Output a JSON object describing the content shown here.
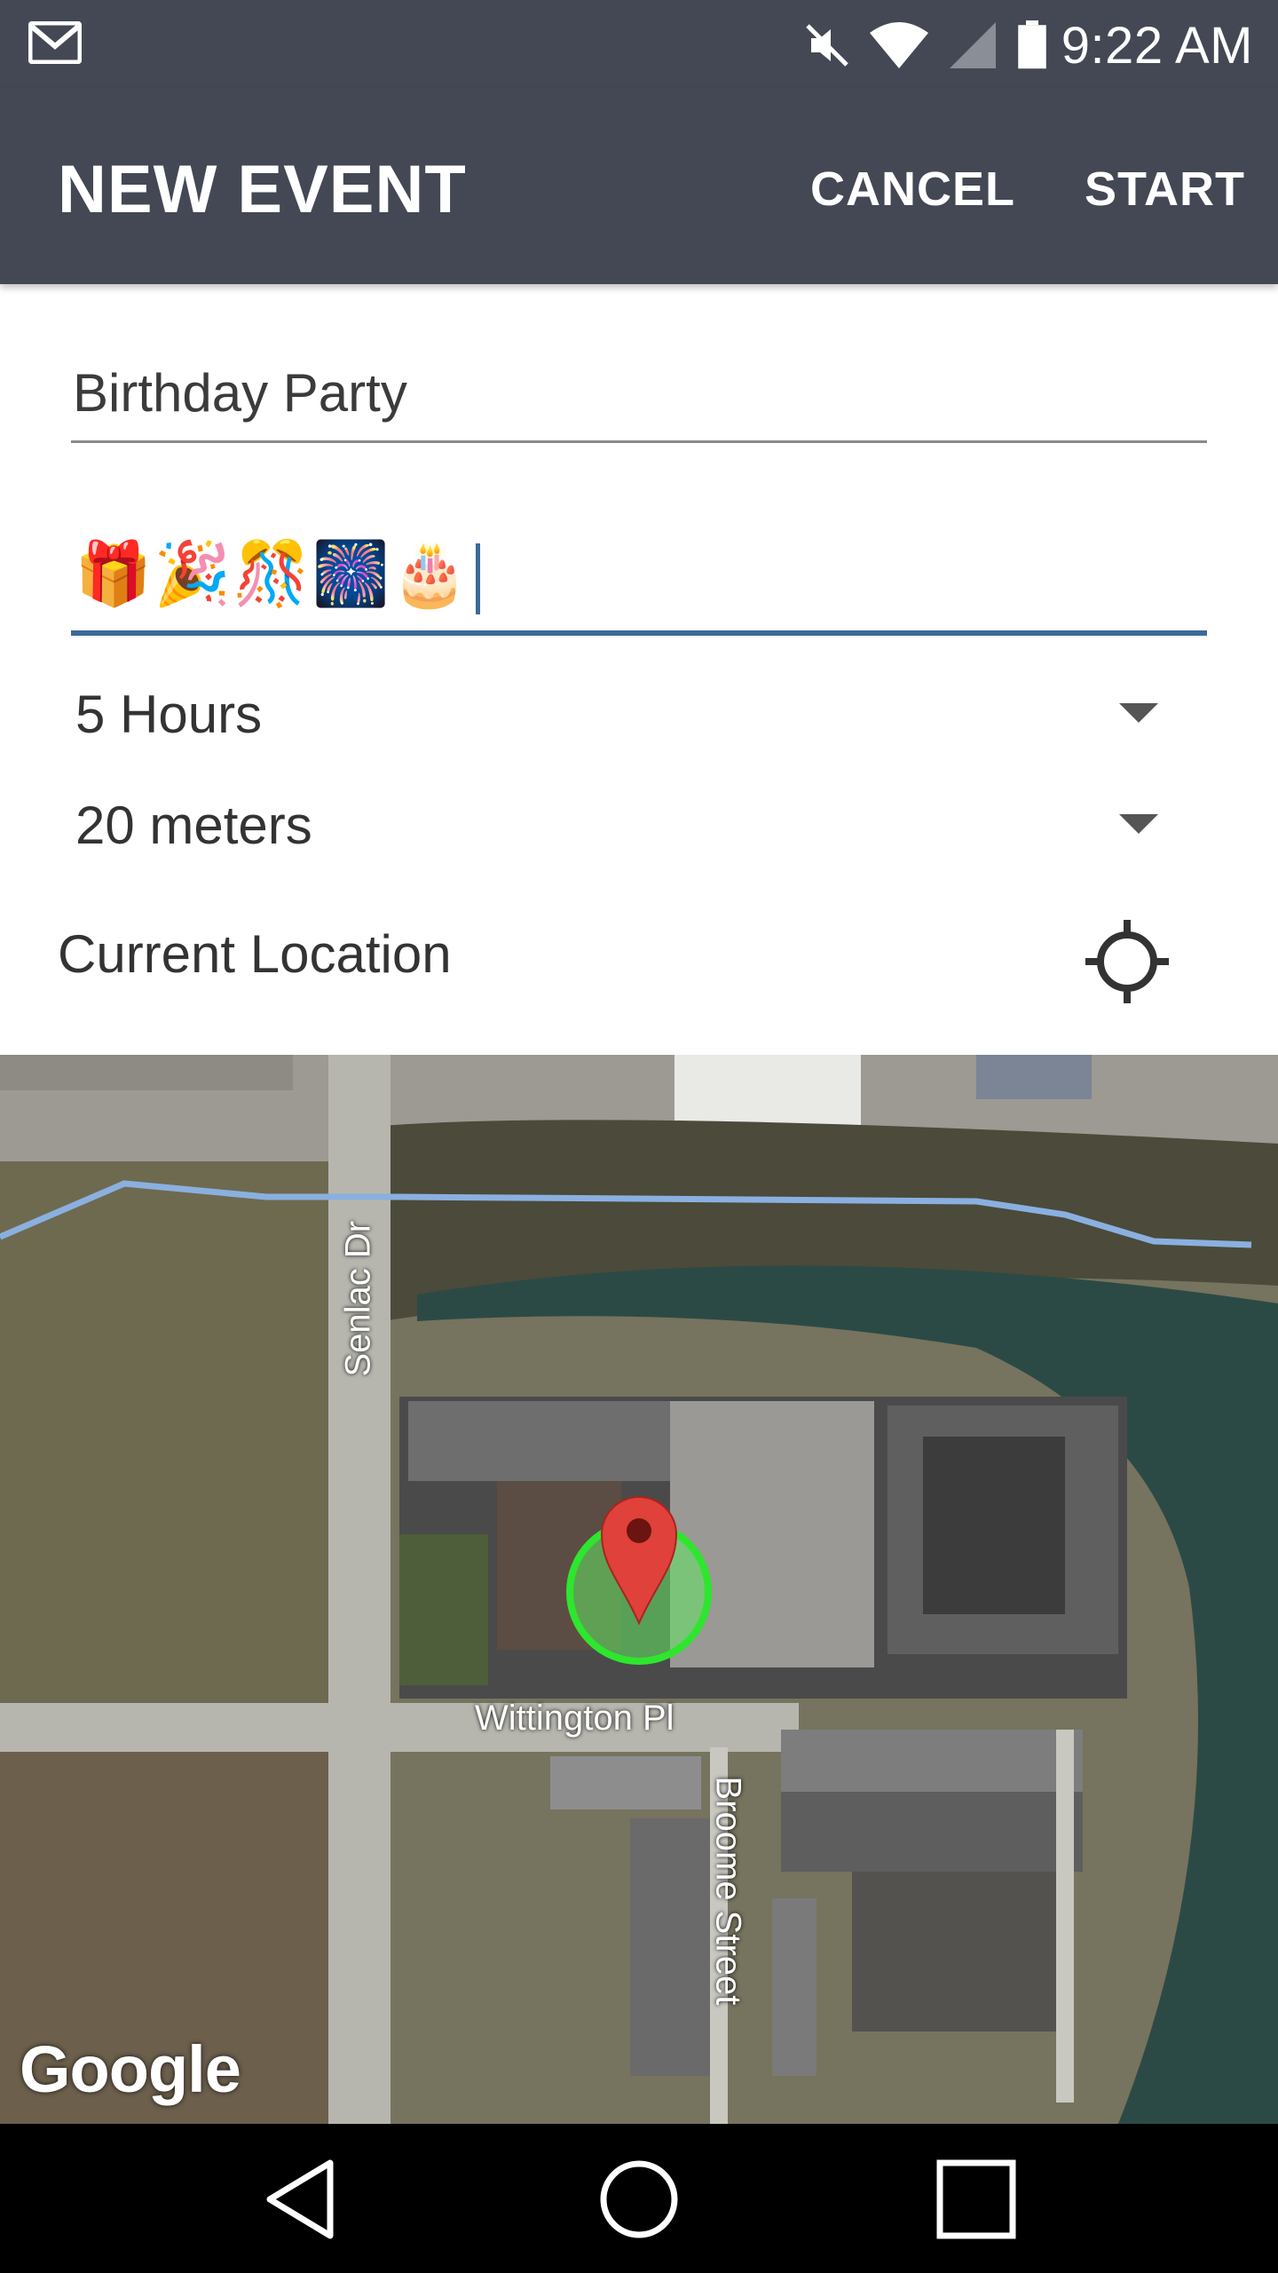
{
  "status_bar": {
    "time": "9:22 AM",
    "icons": [
      "gmail-icon",
      "mute-icon",
      "wifi-icon",
      "signal-icon",
      "battery-icon"
    ]
  },
  "app_bar": {
    "title": "NEW EVENT",
    "cancel_label": "CANCEL",
    "start_label": "START"
  },
  "form": {
    "event_name": "Birthday Party",
    "emoji_value": "🎁🎉🎊🎆🎂",
    "duration": "5 Hours",
    "radius": "20 meters",
    "location_label": "Current Location"
  },
  "map": {
    "labels": {
      "street_1": "Senlac Dr",
      "street_2": "Wittington Pl",
      "street_3": "Broome Street"
    },
    "logo": "Google"
  },
  "colors": {
    "app_bar": "#434854",
    "accent_underline": "#3b6a9a",
    "marker": "#e0413a",
    "radius_circle": "#2ee62e"
  }
}
